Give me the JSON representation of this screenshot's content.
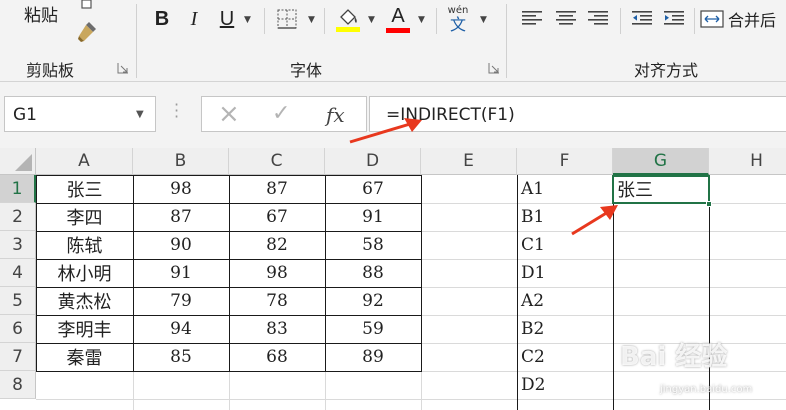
{
  "ribbon": {
    "clipboard": {
      "paste_label": "粘贴",
      "group_label": "剪贴板"
    },
    "font": {
      "group_label": "字体",
      "bold_label": "B",
      "italic_label": "I",
      "underline_label": "U",
      "font_color_label": "A",
      "phonetic_top": "wén",
      "phonetic_bottom": "文",
      "fill_color": "#ffff00",
      "font_color": "#ff0000"
    },
    "alignment": {
      "group_label": "对齐方式",
      "merge_label": "合并后"
    }
  },
  "formula_bar": {
    "name_box": "G1",
    "cancel_icon": "×",
    "enter_icon": "✓",
    "fx_label": "fx",
    "formula": "=INDIRECT(F1)"
  },
  "grid": {
    "columns": [
      "A",
      "B",
      "C",
      "D",
      "E",
      "F",
      "G",
      "H"
    ],
    "active_column": "G",
    "rows": [
      "1",
      "2",
      "3",
      "4",
      "5",
      "6",
      "7",
      "8"
    ],
    "active_row": "1",
    "table": [
      {
        "name": "张三",
        "b": "98",
        "c": "87",
        "d": "67"
      },
      {
        "name": "李四",
        "b": "87",
        "c": "67",
        "d": "91"
      },
      {
        "name": "陈轼",
        "b": "90",
        "c": "82",
        "d": "58"
      },
      {
        "name": "林小明",
        "b": "91",
        "c": "98",
        "d": "88"
      },
      {
        "name": "黄杰松",
        "b": "79",
        "c": "78",
        "d": "92"
      },
      {
        "name": "李明丰",
        "b": "94",
        "c": "83",
        "d": "59"
      },
      {
        "name": "秦雷",
        "b": "85",
        "c": "68",
        "d": "89"
      }
    ],
    "f_column": [
      "A1",
      "B1",
      "C1",
      "D1",
      "A2",
      "B2",
      "C2",
      "D2"
    ],
    "g1_value": "张三"
  },
  "colors": {
    "accent_green": "#217346",
    "arrow_red": "#e8381e"
  },
  "watermark": {
    "text": "Bai 经验",
    "sub": "jingyan.baidu.com"
  }
}
